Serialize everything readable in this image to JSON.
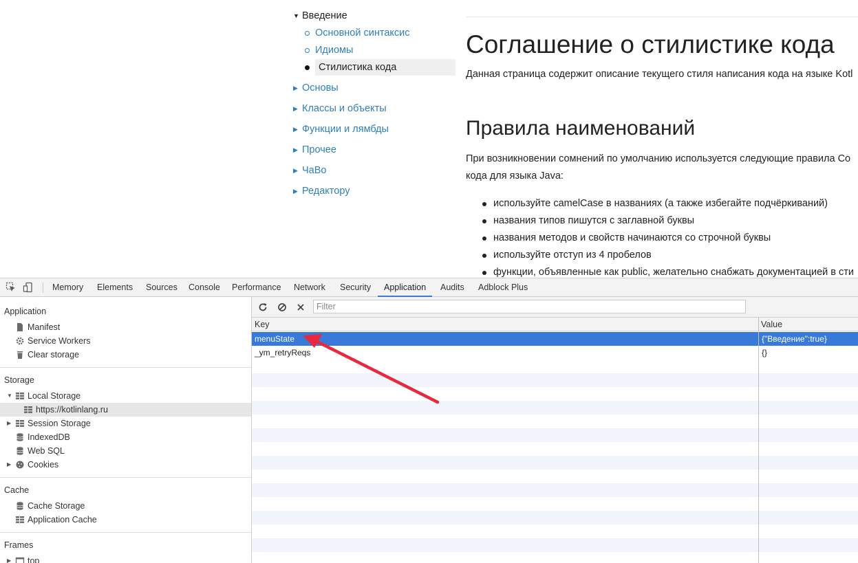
{
  "page": {
    "nav": {
      "open_section": "Введение",
      "sub_items": [
        "Основной синтаксис",
        "Идиомы",
        "Стилистика кода"
      ],
      "active_sub_item": "Стилистика кода",
      "sections": [
        "Основы",
        "Классы и объекты",
        "Функции и лямбды",
        "Прочее",
        "ЧаВо",
        "Редактору"
      ]
    },
    "article": {
      "title": "Соглашение о стилистике кода",
      "intro": "Данная страница содержит описание текущего стиля написания кода на языке Kotl",
      "section_title": "Правила наименований",
      "section_text_line1": "При возникновении сомнений по умолчанию используется следующие правила Co",
      "section_text_line2": "кода для языка Java:",
      "bullets": [
        "используйте camelCase в названиях (а также избегайте подчёркиваний)",
        "названия типов пишутся с заглавной буквы",
        "названия методов и свойств начинаются со строчной буквы",
        "используйте отступ из 4 пробелов",
        "функции, объявленные как public, желательно снабжать документацией в сти"
      ]
    }
  },
  "devtools": {
    "tabs": [
      "Memory",
      "Elements",
      "Sources",
      "Console",
      "Performance",
      "Network",
      "Security",
      "Application",
      "Audits",
      "Adblock Plus"
    ],
    "active_tab": "Application",
    "sidebar": {
      "application": {
        "title": "Application",
        "items": [
          "Manifest",
          "Service Workers",
          "Clear storage"
        ]
      },
      "storage": {
        "title": "Storage",
        "local_storage": "Local Storage",
        "local_storage_origin": "https://kotlinlang.ru",
        "items": [
          "Session Storage",
          "IndexedDB",
          "Web SQL",
          "Cookies"
        ]
      },
      "cache": {
        "title": "Cache",
        "items": [
          "Cache Storage",
          "Application Cache"
        ]
      },
      "frames": {
        "title": "Frames",
        "items": [
          "top"
        ]
      }
    },
    "filter_placeholder": "Filter",
    "table": {
      "headers": {
        "key": "Key",
        "value": "Value"
      },
      "rows": [
        {
          "key": "menuState",
          "value": "{\"Введение\":true}"
        },
        {
          "key": "_ym_retryReqs",
          "value": "{}"
        }
      ],
      "selected_row": 0
    },
    "annotation": {
      "arrow_color": "#e8283c"
    },
    "accent_color": "#3879d9"
  }
}
